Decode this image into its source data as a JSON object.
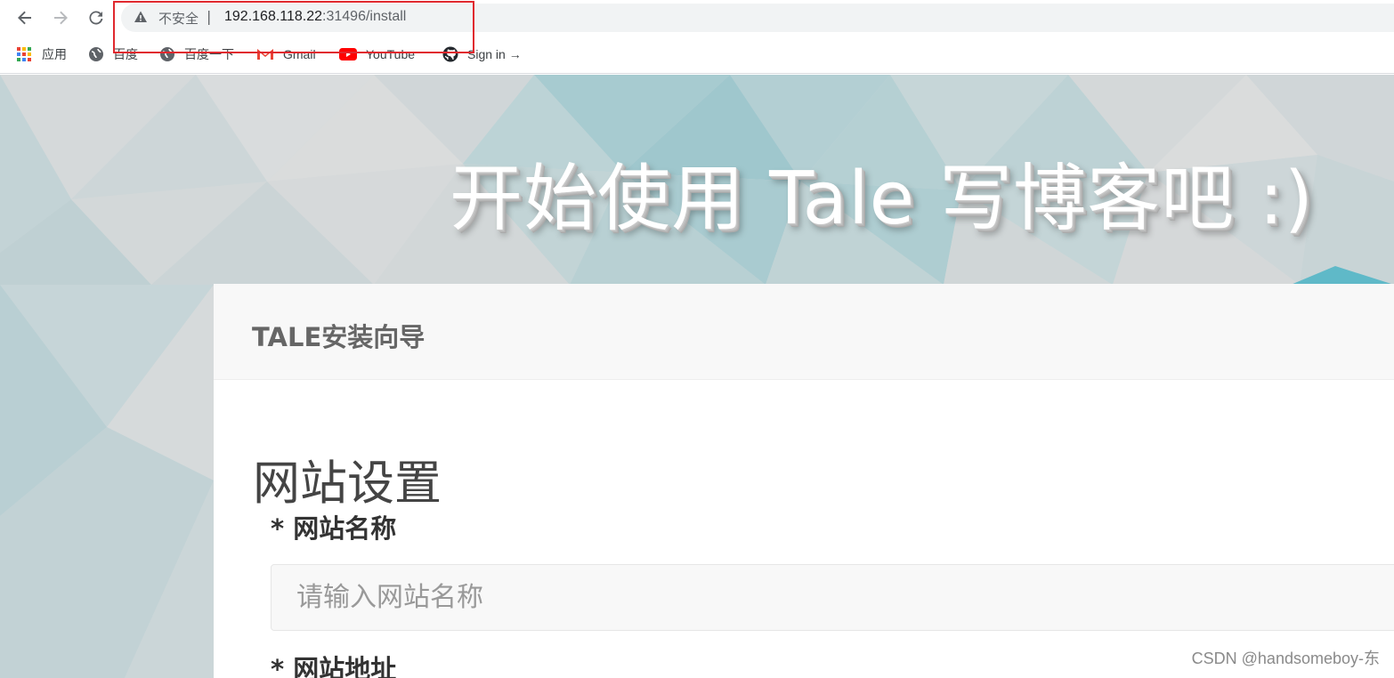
{
  "browser": {
    "security_label": "不安全",
    "separator": "|",
    "url_host": "192.168.118.22",
    "url_path": ":31496/install"
  },
  "bookmarks": [
    {
      "label": "应用",
      "icon": "apps-grid-icon"
    },
    {
      "label": "百度",
      "icon": "globe-icon"
    },
    {
      "label": "百度一下",
      "icon": "globe-icon"
    },
    {
      "label": "Gmail",
      "icon": "gmail-icon"
    },
    {
      "label": "YouTube",
      "icon": "youtube-icon"
    },
    {
      "label": "Sign in →",
      "icon": "github-icon"
    }
  ],
  "hero": {
    "title": "开始使用 Tale 写博客吧 :)"
  },
  "wizard": {
    "title": "TALE安装向导",
    "section_title": "网站设置",
    "site_name_label": "* 网站名称",
    "site_name_placeholder": "请输入网站名称",
    "site_url_label": "* 网站地址"
  },
  "watermark": "CSDN @handsomeboy-东",
  "colors": {
    "highlight_box": "#e0282e",
    "omnibox_bg": "#f1f3f4",
    "card_header_bg": "#f8f8f8"
  }
}
